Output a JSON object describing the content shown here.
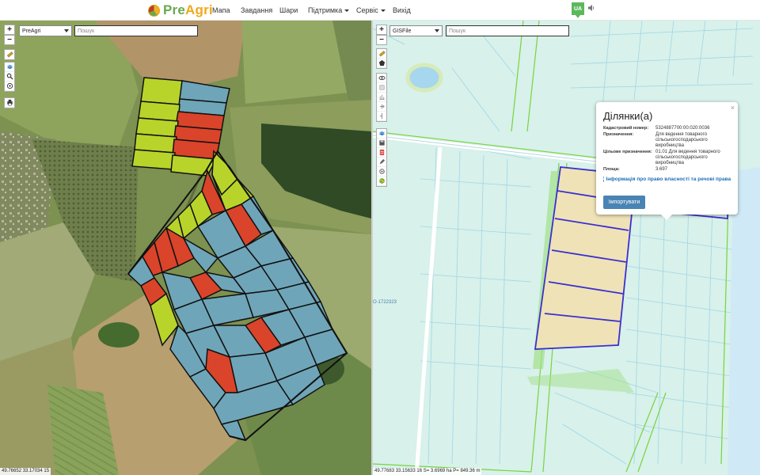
{
  "navbar": {
    "brand_part1": "Pre",
    "brand_part2": "Agri",
    "items": [
      {
        "label": "Мапа"
      },
      {
        "label": "Завдання"
      },
      {
        "label": "Шари"
      },
      {
        "label": "Підтримка"
      },
      {
        "label": "Сервіс"
      },
      {
        "label": "Вихід"
      }
    ],
    "language": "UA"
  },
  "left_map": {
    "zoom_in": "+",
    "zoom_out": "−",
    "layer_select": "PreAgri",
    "search_placeholder": "Пошук",
    "coords": "49.76652 33.17034 15",
    "tools": [
      "ruler-icon",
      "layers-icon",
      "search-icon",
      "target-icon",
      "print-icon"
    ]
  },
  "right_map": {
    "zoom_in": "+",
    "zoom_out": "−",
    "layer_select": "GISFile",
    "search_placeholder": "Пошук",
    "coords": "49.77683 33.15633 16",
    "measure": "S= 3.6969 ha P= 849.36 m",
    "parcel_label": "О-1722323",
    "tools": [
      "ruler-icon",
      "polygon-icon",
      "eye-icon",
      "square-icon",
      "chart-icon",
      "split-icon",
      "merge-icon",
      "layers-icon",
      "save-icon",
      "doc-icon",
      "edit-icon",
      "gear-icon",
      "globe-icon"
    ]
  },
  "popup": {
    "title": "Ділянки(а)",
    "close": "×",
    "rows": [
      {
        "key": "Кадастровий номер:",
        "value": "5324887700:00:020:0036"
      },
      {
        "key": "Призначення:",
        "value": "Для ведення товарного сільськогосподарського виробництва"
      },
      {
        "key": "Цільове призначення:",
        "value": "01.01 Для ведення товарного сільськогосподарського виробництва"
      },
      {
        "key": "Площа:",
        "value": "3.697"
      }
    ],
    "info_link": "Інформація про право власності та речові права",
    "import_button": "Імпортувати"
  },
  "colors": {
    "brand_green": "#6aa84f",
    "brand_orange": "#f0a81c",
    "field_green": "#b8d42b",
    "field_red": "#d9442a",
    "field_blue": "#6fa5b8",
    "parcel_fill": "#efe2b6",
    "parcel_border": "#3b2fd0",
    "cadastre_bg": "#d8f1ea",
    "import_button": "#4a84b4"
  }
}
